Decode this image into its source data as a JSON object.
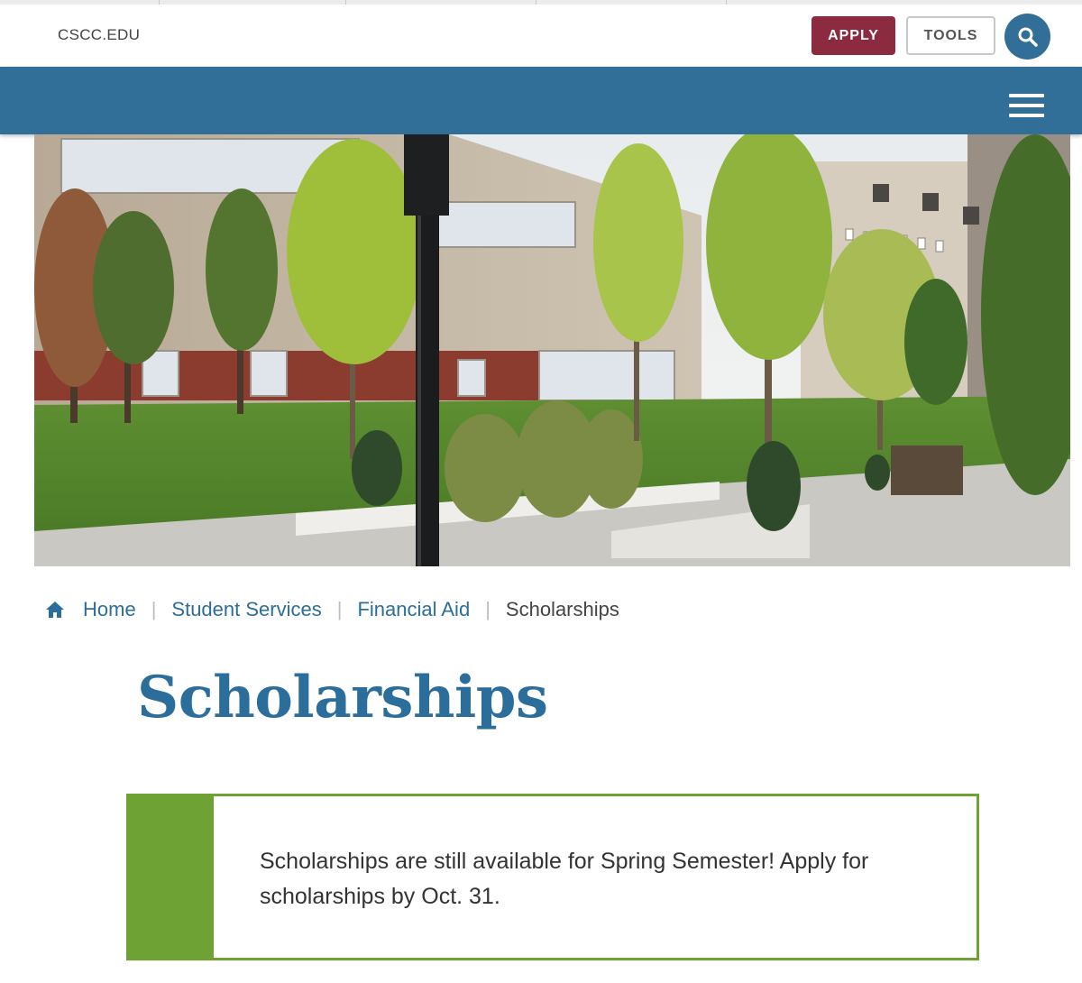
{
  "header": {
    "site_link": "CSCC.EDU",
    "apply_label": "APPLY",
    "tools_label": "TOOLS",
    "search_icon": "search-icon",
    "menu_icon": "hamburger-menu-icon"
  },
  "hero": {
    "alt": "Campus buildings with trees and landscaped walkway"
  },
  "breadcrumb": {
    "home_icon": "home-icon",
    "items": [
      {
        "label": "Home"
      },
      {
        "label": "Student Services"
      },
      {
        "label": "Financial Aid"
      },
      {
        "label": "Scholarships"
      }
    ]
  },
  "main": {
    "title": "Scholarships",
    "callout_text": "Scholarships are still available for Spring Semester! Apply for scholarships by Oct. 31."
  },
  "colors": {
    "primary_blue": "#316e98",
    "apply_maroon": "#8c2b3f",
    "callout_green": "#6ea234",
    "link_blue": "#2c6e9b"
  }
}
